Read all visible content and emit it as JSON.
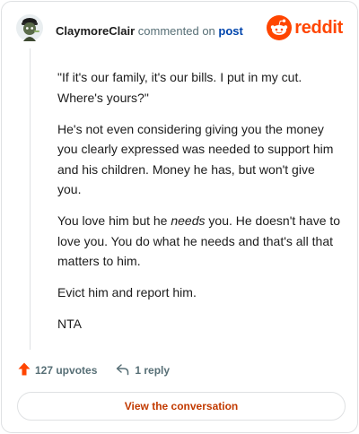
{
  "header": {
    "username": "ClaymoreClair",
    "action": "commented on",
    "post_link": "post",
    "brand": "reddit"
  },
  "comment": {
    "paragraphs": [
      "\"If it's our family, it's our bills. I put in my cut. Where's yours?\"",
      "He's not even considering giving you the money you clearly expressed was needed to support him and his children. Money he has, but won't give you.",
      "Evict him and report him.",
      "NTA"
    ],
    "p3_before": "You love him but he ",
    "p3_em": "needs",
    "p3_after": " you. He doesn't have to love you. You do what he needs and that's all that matters to him."
  },
  "actions": {
    "upvotes": "127 upvotes",
    "replies": "1 reply"
  },
  "cta": {
    "label": "View the conversation"
  },
  "colors": {
    "brand": "#ff4500",
    "link": "#0045ac",
    "cta_text": "#c23a00",
    "muted": "#576f76"
  },
  "icons": {
    "avatar": "snoo-avatar",
    "brand": "reddit-snoo-icon",
    "upvote": "upvote-arrow-icon",
    "reply": "reply-arrow-icon"
  }
}
